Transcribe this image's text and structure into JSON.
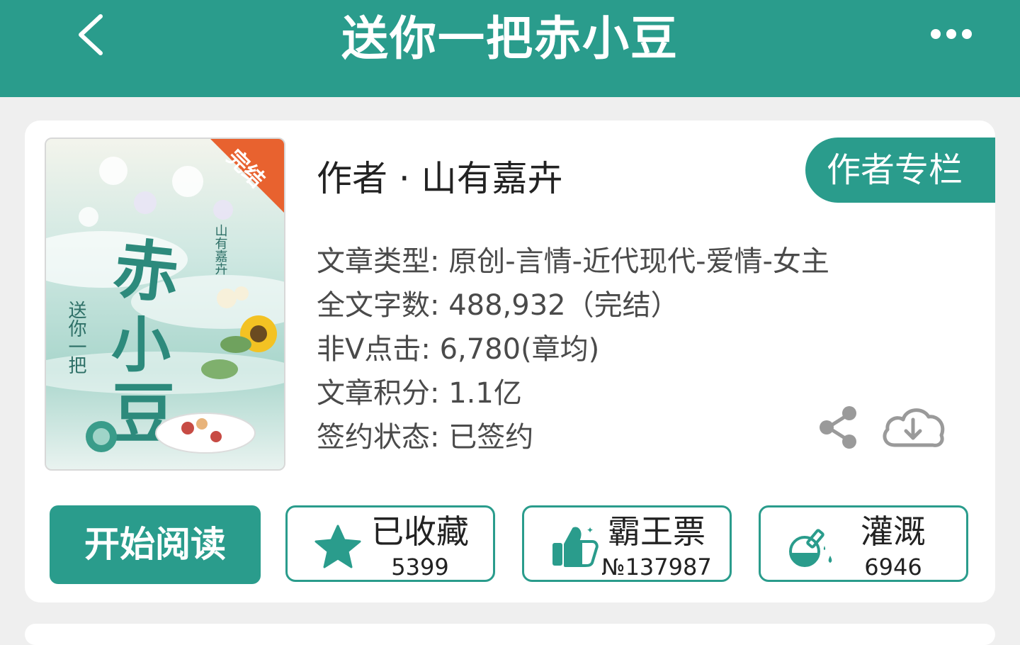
{
  "header": {
    "title": "送你一把赤小豆",
    "back_icon": "chevron-left-icon",
    "more_icon": "more-dots-icon"
  },
  "colors": {
    "accent": "#2a9c8c",
    "badge": "#e8622f",
    "background": "#efefef"
  },
  "book": {
    "cover": {
      "badge": "完结",
      "title_art": "赤小豆",
      "subtitle_art": "送你一把",
      "author_art": "山有嘉卉"
    },
    "author": "作者 · 山有嘉卉",
    "author_column_label": "作者专栏",
    "meta": [
      {
        "label": "文章类型: ",
        "value": "原创-言情-近代现代-爱情-女主"
      },
      {
        "label": "全文字数: ",
        "value": "488,932（完结）"
      },
      {
        "label": "非V点击: ",
        "value": "6,780(章均)"
      },
      {
        "label": "文章积分: ",
        "value": "1.1亿"
      },
      {
        "label": "签约状态: ",
        "value": "已签约"
      }
    ]
  },
  "actions": {
    "read_label": "开始阅读",
    "favorite": {
      "label": "已收藏",
      "count": "5399",
      "icon": "star-icon"
    },
    "ticket": {
      "label": "霸王票",
      "count": "№137987",
      "icon": "thumbs-up-icon"
    },
    "water": {
      "label": "灌溉",
      "count": "6946",
      "icon": "flask-icon"
    },
    "share_icon": "share-icon",
    "download_icon": "cloud-download-icon"
  }
}
